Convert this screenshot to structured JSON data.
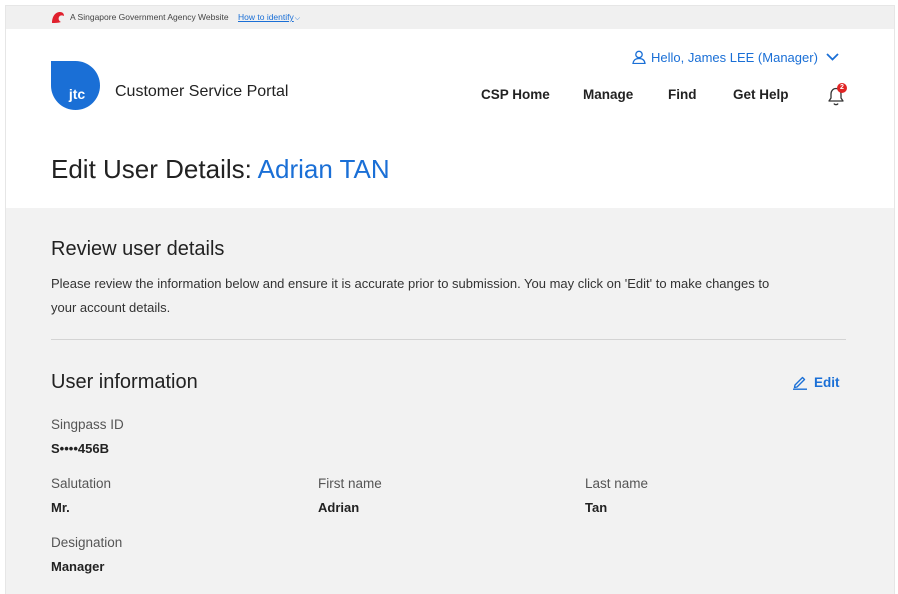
{
  "masthead": {
    "gov_text": "A Singapore Government Agency Website",
    "identify_link": "How to identify"
  },
  "header": {
    "user_greeting": "Hello, James LEE (Manager)",
    "logo_text": "jtc",
    "portal_name": "Customer Service Portal",
    "nav": [
      "CSP Home",
      "Manage",
      "Find",
      "Get Help"
    ],
    "notification_count": "2"
  },
  "page": {
    "title_prefix": "Edit User Details:",
    "title_name": "Adrian TAN"
  },
  "review": {
    "title": "Review user details",
    "description": "Please review the information below and ensure it is accurate prior to submission. You may click on 'Edit' to make changes to your account details."
  },
  "user_info": {
    "title": "User information",
    "edit_label": "Edit",
    "fields": {
      "singpass_id": {
        "label": "Singpass ID",
        "value": "S••••456B"
      },
      "salutation": {
        "label": "Salutation",
        "value": "Mr."
      },
      "first_name": {
        "label": "First name",
        "value": "Adrian"
      },
      "last_name": {
        "label": "Last name",
        "value": "Tan"
      },
      "designation": {
        "label": "Designation",
        "value": "Manager"
      }
    }
  },
  "colors": {
    "accent": "#1a6fd6",
    "content_bg": "#f2f2f2",
    "masthead_bg": "#f0f0f0",
    "lion_red": "#e0202d"
  }
}
